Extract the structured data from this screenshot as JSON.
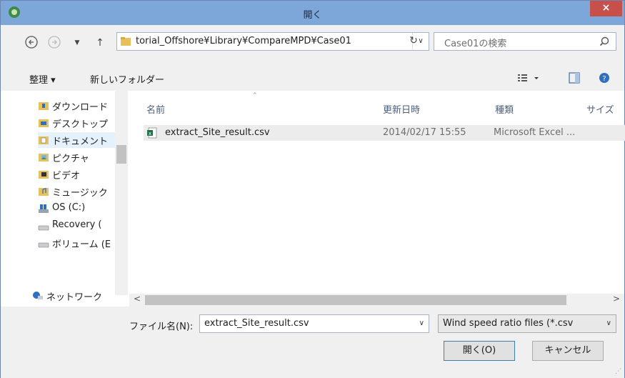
{
  "window": {
    "title": "開く",
    "close": "×"
  },
  "nav": {
    "address": "torial_Offshore¥Library¥CompareMPD¥Case01",
    "search_placeholder": "Case01の検索"
  },
  "toolbar": {
    "organize": "整理 ▾",
    "new_folder": "新しいフォルダー"
  },
  "sidebar": {
    "items": [
      {
        "label": "ダウンロード",
        "icon": "download-folder-icon"
      },
      {
        "label": "デスクトップ",
        "icon": "desktop-folder-icon"
      },
      {
        "label": "ドキュメント",
        "icon": "documents-folder-icon"
      },
      {
        "label": "ピクチャ",
        "icon": "pictures-folder-icon"
      },
      {
        "label": "ビデオ",
        "icon": "videos-folder-icon"
      },
      {
        "label": "ミュージック",
        "icon": "music-folder-icon"
      },
      {
        "label": "OS (C:)",
        "icon": "os-drive-icon"
      },
      {
        "label": "Recovery (",
        "icon": "drive-icon"
      },
      {
        "label": "ボリューム (E",
        "icon": "drive-icon"
      },
      {
        "label": "ネットワーク",
        "icon": "network-icon"
      }
    ]
  },
  "columns": {
    "name": "名前",
    "modified": "更新日時",
    "type": "種類",
    "size": "サイズ"
  },
  "files": [
    {
      "name": "extract_Site_result.csv",
      "modified": "2014/02/17 15:55",
      "type": "Microsoft Excel ..."
    }
  ],
  "bottom": {
    "filename_label": "ファイル名(N):",
    "filename_value": "extract_Site_result.csv",
    "filetype_value": "Wind speed ratio files (*.csv",
    "open_button": "開く(O)",
    "cancel_button": "キャンセル"
  },
  "colors": {
    "titlebar": "#7da7d9",
    "close": "#c7504b",
    "selection": "#e5f1fb"
  }
}
